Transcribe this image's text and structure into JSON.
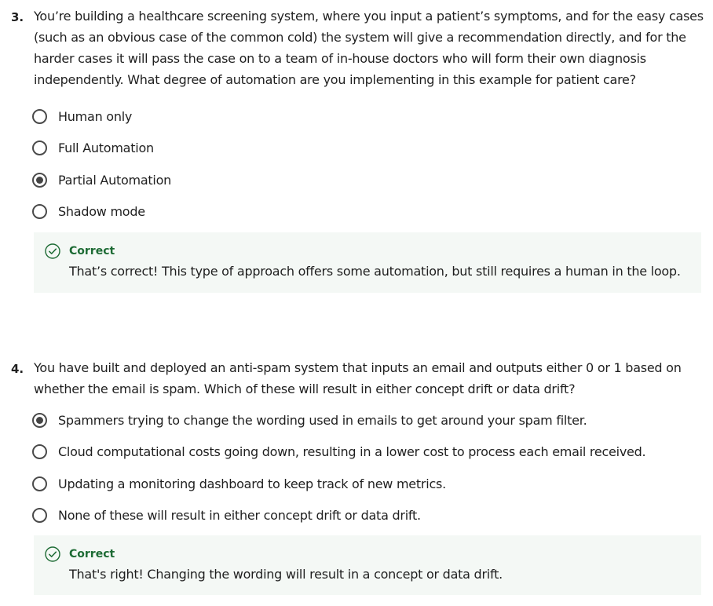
{
  "questions": [
    {
      "number": "3.",
      "text": "You’re building a healthcare screening system, where you input a patient’s symptoms, and for the easy cases (such as an obvious case of the common cold) the system will give a recommendation directly, and for the harder cases it will pass the case on to a team of in-house doctors who will form their own diagnosis independently. What degree of automation are you implementing in this example for patient care?",
      "options": [
        {
          "label": "Human only",
          "selected": false
        },
        {
          "label": "Full Automation",
          "selected": false
        },
        {
          "label": "Partial Automation",
          "selected": true
        },
        {
          "label": "Shadow mode",
          "selected": false
        }
      ],
      "feedback": {
        "status": "Correct",
        "icon": "check-circle-icon",
        "message": "That’s correct! This type of approach offers some automation, but still requires a human in the loop."
      }
    },
    {
      "number": "4.",
      "text": "You have built and deployed an anti-spam system that inputs an email and outputs either 0 or 1 based on whether the email is spam. Which of these will result in either concept drift or data drift?",
      "options": [
        {
          "label": "Spammers trying to change the wording used in emails to get around your spam filter.",
          "selected": true
        },
        {
          "label": "Cloud computational costs going down, resulting in a lower cost to process each email received.",
          "selected": false
        },
        {
          "label": "Updating a monitoring dashboard to keep track of new metrics.",
          "selected": false
        },
        {
          "label": "None of these will result in either concept drift or data drift.",
          "selected": false
        }
      ],
      "feedback": {
        "status": "Correct",
        "icon": "check-circle-icon",
        "message": "That's right! Changing the wording will result in a concept or data drift."
      }
    }
  ],
  "colors": {
    "correct_green": "#1d6b34",
    "feedback_bg": "#f4f8f5",
    "radio_border": "#4a4a4a"
  }
}
